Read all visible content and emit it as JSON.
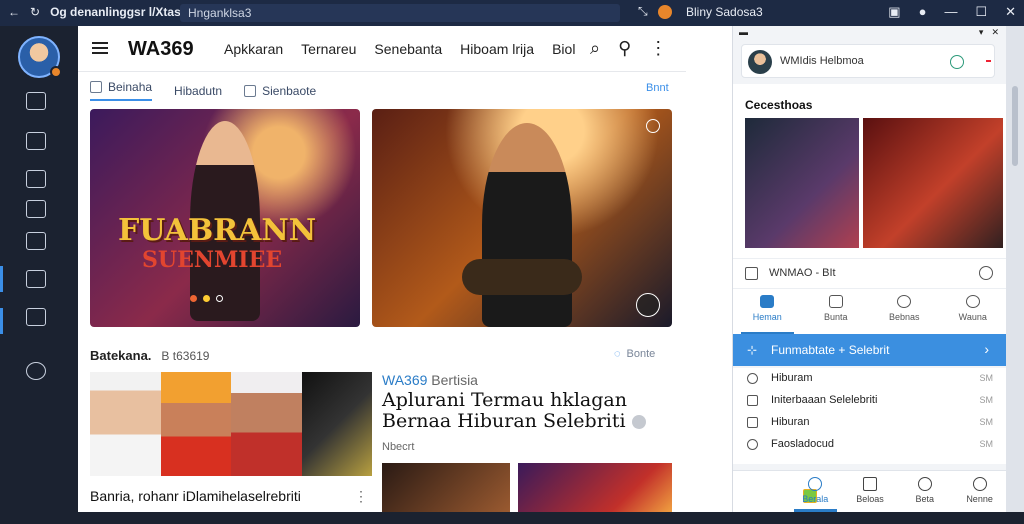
{
  "titlebar": {
    "tab_title": "Og denanlinggsr l/Xtas",
    "address": "Hnganklsa3",
    "right_title": "Bliny Sadosa3",
    "controls": [
      "—",
      "☐",
      "✕"
    ]
  },
  "header": {
    "logo": "WA369",
    "nav": [
      "Apkkaran",
      "Ternareu",
      "Senebanta",
      "Hiboam lrija",
      "Biol"
    ]
  },
  "filters": {
    "items": [
      {
        "label": "Beinaha"
      },
      {
        "label": "Hibadutn"
      },
      {
        "label": "Sienbaote"
      }
    ],
    "sort": "Bnnt"
  },
  "section": {
    "title": "Batekana.",
    "subtitle": "B t63619",
    "more": "Bonte"
  },
  "poster": {
    "title": "FUABRANN",
    "subtitle": "SUENMIEE"
  },
  "article": {
    "brand": "WA369",
    "brand_suffix": "Bertisia",
    "headline": "Aplurani Termau hklagan Bernaa Hiburan Selebriti",
    "meta": "Nbecrt",
    "bottom_text": "Banria, rohanr iDlamihelaselrebriti",
    "bottom_more": "⋮"
  },
  "phone": {
    "status_right": [
      "▾",
      "✕"
    ],
    "search_text": "WMIdis Helbmoa",
    "content_title": "Cecesthoas",
    "row_label": "WNMAO - BIt",
    "tabs": [
      {
        "label": "Heman",
        "icon": "home-icon",
        "active": true
      },
      {
        "label": "Bunta",
        "icon": "grid-icon",
        "active": false
      },
      {
        "label": "Bebnas",
        "icon": "heart-icon",
        "active": false
      },
      {
        "label": "Wauna",
        "icon": "group-icon",
        "active": false
      }
    ],
    "banner": {
      "text": "Funmabtate + Selebrit",
      "chevron": "›"
    },
    "list": [
      {
        "label": "Hiburam",
        "value": "SM"
      },
      {
        "label": "Initerbaaan Selelebriti",
        "value": "SM"
      },
      {
        "label": "Hiburan",
        "value": "SM"
      },
      {
        "label": "Faosladocud",
        "value": "SM"
      }
    ],
    "nav": [
      {
        "label": "Berala",
        "active": true
      },
      {
        "label": "Beloas",
        "active": false
      },
      {
        "label": "Beta",
        "active": false
      },
      {
        "label": "Nenne",
        "active": false
      }
    ]
  },
  "colors": {
    "accent": "#3b8fe0",
    "brand_blue": "#2a7cc7",
    "titlebar": "#1d2a44",
    "rail": "#1b2230"
  }
}
